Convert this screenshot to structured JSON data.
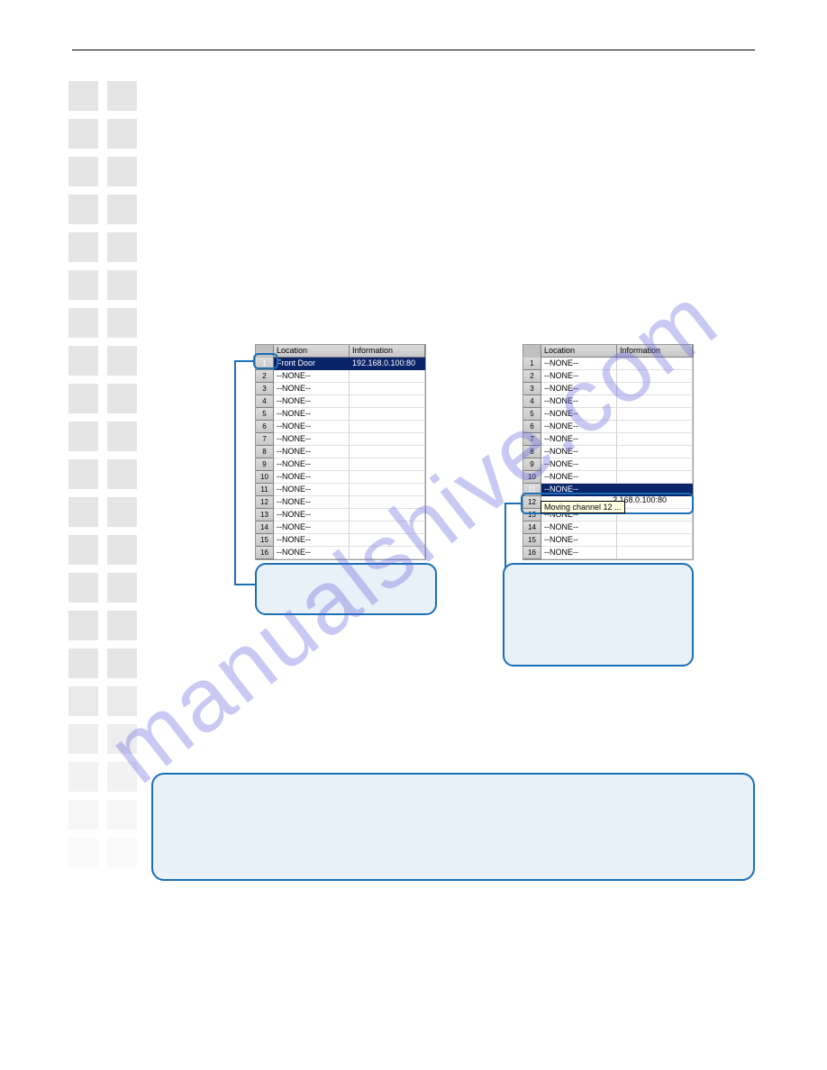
{
  "watermark": "manualshive.com",
  "tables": {
    "headers": {
      "num": "",
      "location": "Location",
      "information": "Information"
    },
    "left_rows": [
      {
        "n": "1",
        "loc": "Front Door",
        "inf": "192.168.0.100:80",
        "sel": true
      },
      {
        "n": "2",
        "loc": "--NONE--",
        "inf": ""
      },
      {
        "n": "3",
        "loc": "--NONE--",
        "inf": ""
      },
      {
        "n": "4",
        "loc": "--NONE--",
        "inf": ""
      },
      {
        "n": "5",
        "loc": "--NONE--",
        "inf": ""
      },
      {
        "n": "6",
        "loc": "--NONE--",
        "inf": ""
      },
      {
        "n": "7",
        "loc": "--NONE--",
        "inf": ""
      },
      {
        "n": "8",
        "loc": "--NONE--",
        "inf": ""
      },
      {
        "n": "9",
        "loc": "--NONE--",
        "inf": ""
      },
      {
        "n": "10",
        "loc": "--NONE--",
        "inf": ""
      },
      {
        "n": "11",
        "loc": "--NONE--",
        "inf": ""
      },
      {
        "n": "12",
        "loc": "--NONE--",
        "inf": ""
      },
      {
        "n": "13",
        "loc": "--NONE--",
        "inf": ""
      },
      {
        "n": "14",
        "loc": "--NONE--",
        "inf": ""
      },
      {
        "n": "15",
        "loc": "--NONE--",
        "inf": ""
      },
      {
        "n": "16",
        "loc": "--NONE--",
        "inf": ""
      }
    ],
    "right_rows": [
      {
        "n": "1",
        "loc": "--NONE--",
        "inf": ""
      },
      {
        "n": "2",
        "loc": "--NONE--",
        "inf": ""
      },
      {
        "n": "3",
        "loc": "--NONE--",
        "inf": ""
      },
      {
        "n": "4",
        "loc": "--NONE--",
        "inf": ""
      },
      {
        "n": "5",
        "loc": "--NONE--",
        "inf": ""
      },
      {
        "n": "6",
        "loc": "--NONE--",
        "inf": ""
      },
      {
        "n": "7",
        "loc": "--NONE--",
        "inf": ""
      },
      {
        "n": "8",
        "loc": "--NONE--",
        "inf": ""
      },
      {
        "n": "9",
        "loc": "--NONE--",
        "inf": ""
      },
      {
        "n": "10",
        "loc": "--NONE--",
        "inf": ""
      },
      {
        "n": "11",
        "loc": "--NONE--",
        "inf": "",
        "sel": true
      },
      {
        "n": "12",
        "loc": "",
        "inf": ""
      },
      {
        "n": "13",
        "loc": "--NONE--",
        "inf": ""
      },
      {
        "n": "14",
        "loc": "--NONE--",
        "inf": ""
      },
      {
        "n": "15",
        "loc": "--NONE--",
        "inf": ""
      },
      {
        "n": "16",
        "loc": "--NONE--",
        "inf": ""
      }
    ]
  },
  "drag_tip": "Moving channel 12 ...",
  "drag_info_extra": "2.168.0.100:80"
}
